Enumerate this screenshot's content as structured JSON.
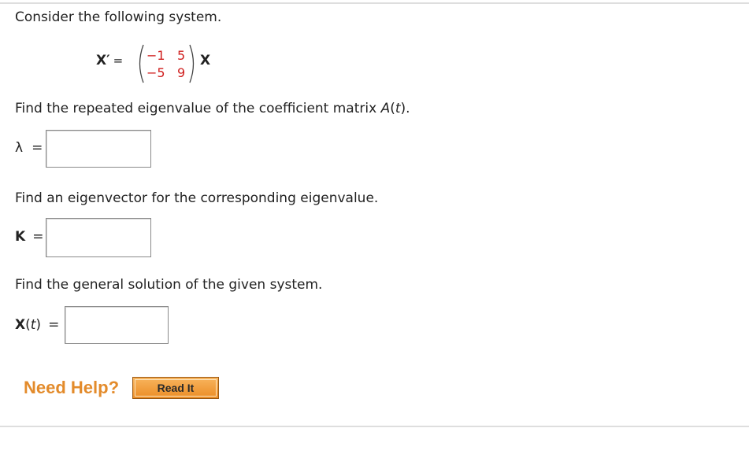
{
  "intro": "Consider the following system.",
  "system": {
    "lhs": "X′",
    "equals": "=",
    "matrix": [
      [
        "−1",
        "5"
      ],
      [
        "−5",
        "9"
      ]
    ],
    "rhs": "X"
  },
  "q1": {
    "prompt_pre": "Find the repeated eigenvalue of the coefficient matrix ",
    "prompt_var": "A",
    "prompt_paren_open": "(",
    "prompt_t": "t",
    "prompt_post": ").",
    "label": "λ",
    "equals": "="
  },
  "q2": {
    "prompt": "Find an eigenvector for the corresponding eigenvalue.",
    "label": "K",
    "equals": "="
  },
  "q3": {
    "prompt": "Find the general solution of the given system.",
    "label_main": "X",
    "label_paren_open": "(",
    "label_t": "t",
    "label_paren_close": ")",
    "equals": "="
  },
  "help": {
    "title": "Need Help?",
    "read_it": "Read It"
  }
}
